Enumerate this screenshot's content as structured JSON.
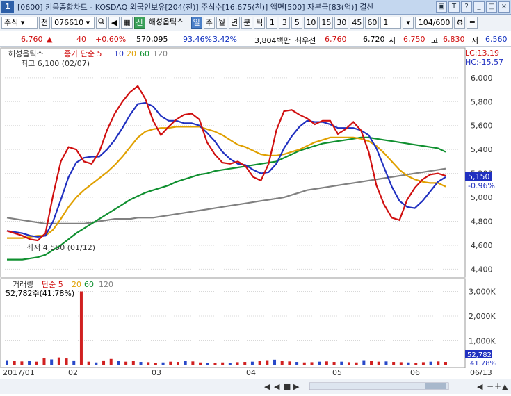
{
  "title_bar": {
    "number": "1",
    "title": "[0600] 키움종합차트 - KOSDAQ 외국인보유[204(천)] 주식수[16,675(천)] 액면[500] 자본금[83(억)] 결산",
    "buttons": [
      "▣",
      "T",
      "?",
      "_",
      "□",
      "×"
    ]
  },
  "toolbar": {
    "market": "주식",
    "period_btn": "전",
    "code": "076610",
    "name": "해성옵틱스",
    "tabs": [
      "일",
      "주",
      "월",
      "년",
      "분",
      "틱"
    ],
    "active_tab": "일",
    "intervals": [
      "1",
      "3",
      "5",
      "10",
      "15",
      "30",
      "45",
      "60"
    ],
    "interval_value": "1",
    "count": "104/600",
    "shin": "신"
  },
  "quote": {
    "price": "6,760",
    "arrow": "▲",
    "change": "40",
    "change_pct": "+0.60%",
    "volume": "570,095",
    "ratio1": "93.46%",
    "ratio2": "3.42%",
    "amount": "3,804백만",
    "best_label": "최우선",
    "best_ask": "6,760",
    "best_bid": "6,720",
    "open_label": "시",
    "open": "6,750",
    "high_label": "고",
    "high": "6,830",
    "low_label": "저",
    "low": "6,560"
  },
  "chart_data": [
    {
      "type": "line",
      "title": "해성옵틱스",
      "legend": [
        {
          "name": "종가 단순 5",
          "color": "#d01010"
        },
        {
          "name": "10",
          "color": "#2030c0"
        },
        {
          "name": "20",
          "color": "#e0a000"
        },
        {
          "name": "60",
          "color": "#109030"
        },
        {
          "name": "120",
          "color": "#808080"
        }
      ],
      "y_ticks": [
        "6,000",
        "5,800",
        "5,600",
        "5,400",
        "5,200",
        "5,000",
        "4,800",
        "4,600",
        "4,400"
      ],
      "ylim": [
        4350,
        6150
      ],
      "x_ticks": [
        "2017/01",
        "02",
        "03",
        "04",
        "05",
        "06",
        "06/13"
      ],
      "annotations": {
        "high": "최고 6,100 (02/07)",
        "low": "최저 4,550 (01/12)",
        "lc": "LC:13.19",
        "hc": "HC:-15.57",
        "last": "5,150",
        "last_pct": "-0.96%"
      },
      "series": [
        {
          "name": "종가 단순 5",
          "color": "#d01010",
          "values": [
            4720,
            4700,
            4680,
            4650,
            4640,
            4700,
            5020,
            5300,
            5420,
            5400,
            5300,
            5280,
            5380,
            5560,
            5700,
            5800,
            5880,
            5930,
            5820,
            5640,
            5520,
            5590,
            5650,
            5690,
            5700,
            5650,
            5460,
            5360,
            5290,
            5280,
            5300,
            5260,
            5170,
            5140,
            5280,
            5560,
            5720,
            5730,
            5690,
            5660,
            5610,
            5640,
            5640,
            5530,
            5570,
            5630,
            5560,
            5380,
            5100,
            4940,
            4830,
            4810,
            4980,
            5080,
            5150,
            5190,
            5200,
            5180
          ]
        },
        {
          "name": "10",
          "color": "#2030c0",
          "values": [
            4720,
            4710,
            4700,
            4680,
            4670,
            4680,
            4800,
            4980,
            5170,
            5290,
            5330,
            5340,
            5340,
            5400,
            5480,
            5580,
            5690,
            5780,
            5790,
            5760,
            5680,
            5640,
            5640,
            5620,
            5620,
            5600,
            5540,
            5470,
            5380,
            5320,
            5280,
            5270,
            5230,
            5200,
            5210,
            5280,
            5410,
            5510,
            5590,
            5640,
            5630,
            5630,
            5610,
            5580,
            5580,
            5580,
            5560,
            5520,
            5410,
            5250,
            5090,
            4970,
            4920,
            4910,
            4970,
            5050,
            5130,
            5170
          ]
        },
        {
          "name": "20",
          "color": "#e0a000",
          "values": [
            4660,
            4660,
            4660,
            4670,
            4680,
            4680,
            4730,
            4820,
            4920,
            5000,
            5060,
            5110,
            5160,
            5210,
            5270,
            5340,
            5420,
            5500,
            5550,
            5570,
            5580,
            5580,
            5590,
            5590,
            5590,
            5590,
            5570,
            5550,
            5520,
            5480,
            5440,
            5420,
            5390,
            5360,
            5350,
            5350,
            5360,
            5380,
            5400,
            5430,
            5460,
            5480,
            5500,
            5500,
            5500,
            5500,
            5490,
            5470,
            5430,
            5370,
            5300,
            5230,
            5180,
            5150,
            5130,
            5120,
            5120,
            5090
          ]
        },
        {
          "name": "60",
          "color": "#109030",
          "values": [
            4480,
            4480,
            4480,
            4490,
            4500,
            4520,
            4560,
            4600,
            4650,
            4700,
            4740,
            4780,
            4820,
            4860,
            4900,
            4940,
            4980,
            5010,
            5040,
            5060,
            5080,
            5100,
            5130,
            5150,
            5170,
            5190,
            5200,
            5220,
            5230,
            5240,
            5250,
            5260,
            5270,
            5280,
            5290,
            5300,
            5330,
            5360,
            5390,
            5410,
            5430,
            5450,
            5460,
            5470,
            5480,
            5490,
            5500,
            5500,
            5490,
            5480,
            5470,
            5460,
            5450,
            5440,
            5430,
            5420,
            5410,
            5380
          ]
        },
        {
          "name": "120",
          "color": "#808080",
          "values": [
            4830,
            4820,
            4810,
            4800,
            4790,
            4780,
            4780,
            4780,
            4780,
            4780,
            4780,
            4790,
            4800,
            4810,
            4820,
            4820,
            4820,
            4830,
            4830,
            4830,
            4840,
            4850,
            4860,
            4870,
            4880,
            4890,
            4900,
            4910,
            4920,
            4930,
            4940,
            4950,
            4960,
            4970,
            4980,
            4990,
            5000,
            5020,
            5040,
            5060,
            5070,
            5080,
            5090,
            5100,
            5110,
            5120,
            5130,
            5140,
            5150,
            5160,
            5170,
            5180,
            5190,
            5200,
            5210,
            5220,
            5230,
            5240
          ]
        }
      ]
    },
    {
      "type": "bar",
      "title": "거래량",
      "legend": [
        {
          "name": "단순 5",
          "color": "#d01010"
        },
        {
          "name": "20",
          "color": "#e0a000"
        },
        {
          "name": "60",
          "color": "#109030"
        },
        {
          "name": "120",
          "color": "#808080"
        }
      ],
      "readout": "52,782주(41.78%)",
      "y_ticks": [
        "3,000K",
        "2,000K",
        "1,000K"
      ],
      "last_value": "52,782",
      "last_pct": "41.78%",
      "ylim": [
        0,
        3100
      ],
      "values": [
        210,
        180,
        160,
        170,
        150,
        310,
        240,
        320,
        280,
        200,
        3000,
        150,
        120,
        200,
        260,
        180,
        150,
        180,
        140,
        130,
        110,
        120,
        150,
        140,
        170,
        160,
        120,
        110,
        100,
        120,
        110,
        130,
        140,
        150,
        170,
        210,
        230,
        190,
        160,
        140,
        120,
        130,
        150,
        160,
        140,
        150,
        130,
        120,
        210,
        180,
        150,
        160,
        140,
        130,
        120,
        110,
        130,
        150,
        160,
        140
      ]
    }
  ]
}
